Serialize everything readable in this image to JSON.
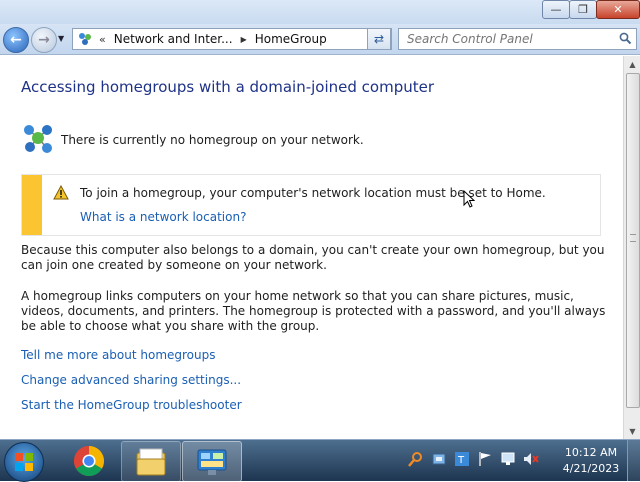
{
  "window": {
    "minimize_symbol": "—",
    "maximize_symbol": "❐",
    "close_symbol": "✕"
  },
  "navigation": {
    "back_icon": "back-arrow-icon",
    "forward_icon": "forward-arrow-icon",
    "breadcrumb_chevron": "«",
    "breadcrumb": [
      "Network and Inter...",
      "HomeGroup"
    ],
    "search_placeholder": "Search Control Panel"
  },
  "content": {
    "title": "Accessing homegroups with a domain-joined computer",
    "status": "There is currently no homegroup on your network.",
    "warning": {
      "text": "To join a homegroup, your computer's network location must be set to Home.",
      "link": "What is a network location?",
      "stripe_color": "#fbc531"
    },
    "paragraphs": [
      "Because this computer also belongs to a domain, you can't create your own homegroup, but you can join one created by someone on your network.",
      "A homegroup links computers on your home network so that you can share pictures, music, videos, documents, and printers. The homegroup is protected with a password, and you'll always be able to choose what you share with the group."
    ],
    "links": [
      "Tell me more about homegroups",
      "Change advanced sharing settings...",
      "Start the HomeGroup troubleshooter"
    ],
    "title_color": "#1e3287",
    "link_color": "#1a5fb4"
  },
  "taskbar": {
    "pinned": [
      "chrome-icon",
      "windows-explorer-icon",
      "control-panel-icon"
    ],
    "tray_icons": [
      "search-icon",
      "tools-icon",
      "text-icon",
      "flag-icon",
      "network-icon",
      "volume-muted-icon"
    ],
    "time": "10:12 AM",
    "date": "4/21/2023"
  }
}
